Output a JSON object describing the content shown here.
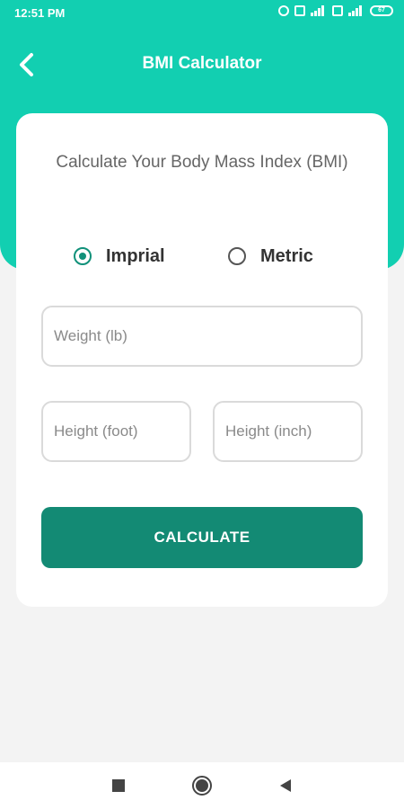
{
  "status_bar": {
    "time": "12:51 PM",
    "battery": "67"
  },
  "appbar": {
    "title": "BMI Calculator"
  },
  "card": {
    "subtitle": "Calculate Your Body Mass Index (BMI)",
    "units": [
      {
        "label": "Imprial",
        "selected": true
      },
      {
        "label": "Metric",
        "selected": false
      }
    ],
    "weight_placeholder": "Weight (lb)",
    "height_foot_placeholder": "Height (foot)",
    "height_inch_placeholder": "Height (inch)",
    "calculate_label": "CALCULATE"
  },
  "colors": {
    "header": "#12cfb1",
    "button": "#138a74",
    "radio_selected": "#11917a"
  },
  "icons": {
    "back": "chevron-left-icon",
    "nav_recents": "square-icon",
    "nav_home": "circle-icon",
    "nav_back": "triangle-icon"
  }
}
